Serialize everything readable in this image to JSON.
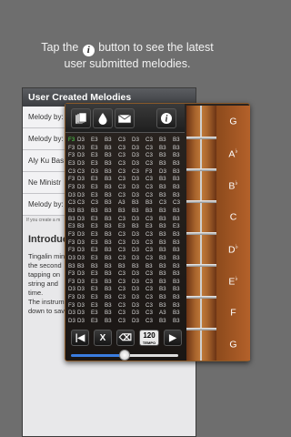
{
  "headline": {
    "line1_before": "Tap the",
    "info_glyph": "i",
    "line1_after": "button to see the latest",
    "line2": "user submitted melodies."
  },
  "background_page": {
    "title": "User Created Melodies",
    "rows": [
      "Melody by:",
      "Melody by:",
      "Aly Ku Bas",
      "Ne Ministr",
      "Melody by:"
    ],
    "note": "If you create a m",
    "intro_heading": "Introduc",
    "intro_lines": [
      "Tingalin min",
      "the second",
      "tapping on",
      "string and",
      "time.",
      "The instrum",
      "down to sav"
    ]
  },
  "toolbar": {
    "icons": [
      "pages-icon",
      "drop-icon",
      "mail-icon",
      "info-icon"
    ]
  },
  "grid_rows": [
    [
      "F3",
      "D3",
      "E3",
      "B3",
      "C3",
      "D3",
      "C3",
      "B3",
      "B3",
      "B3"
    ],
    [
      "F3",
      "D3",
      "E3",
      "B3",
      "C3",
      "D3",
      "C3",
      "B3",
      "B3",
      "B3"
    ],
    [
      "F3",
      "D3",
      "E3",
      "B3",
      "C3",
      "D3",
      "C3",
      "B3",
      "B3",
      "B3"
    ],
    [
      "E3",
      "D3",
      "E3",
      "B3",
      "C3",
      "D3",
      "C3",
      "B3",
      "B3",
      "B3"
    ],
    [
      "C3",
      "C3",
      "D3",
      "B3",
      "C3",
      "C3",
      "F3",
      "D3",
      "B3",
      "B3"
    ],
    [
      "F3",
      "D3",
      "E3",
      "B3",
      "C3",
      "D3",
      "C3",
      "B3",
      "B3",
      "B3"
    ],
    [
      "F3",
      "D3",
      "E3",
      "B3",
      "C3",
      "D3",
      "C3",
      "B3",
      "B3",
      "B3"
    ],
    [
      "D3",
      "D3",
      "E3",
      "B3",
      "C3",
      "D3",
      "C3",
      "B3",
      "B3",
      "B3"
    ],
    [
      "C3",
      "C3",
      "C3",
      "B3",
      "A3",
      "B3",
      "B3",
      "C3",
      "C3",
      ""
    ],
    [
      "B3",
      "B3",
      "B3",
      "B3",
      "B3",
      "B3",
      "B3",
      "B3",
      "B3",
      "B3"
    ],
    [
      "B3",
      "D3",
      "E3",
      "B3",
      "C3",
      "D3",
      "C3",
      "B3",
      "B3",
      "B3"
    ],
    [
      "E3",
      "B3",
      "E3",
      "B3",
      "E3",
      "B3",
      "E3",
      "B3",
      "E3",
      "B3"
    ],
    [
      "F3",
      "D3",
      "E3",
      "B3",
      "C3",
      "D3",
      "C3",
      "B3",
      "B3",
      "B3"
    ],
    [
      "F3",
      "D3",
      "E3",
      "B3",
      "C3",
      "D3",
      "C3",
      "B3",
      "B3",
      "B3"
    ],
    [
      "F3",
      "D3",
      "E3",
      "B3",
      "C3",
      "D3",
      "C3",
      "B3",
      "B3",
      "B3"
    ],
    [
      "D3",
      "D3",
      "E3",
      "B3",
      "C3",
      "D3",
      "C3",
      "B3",
      "B3",
      "B3"
    ],
    [
      "B3",
      "B3",
      "B3",
      "B3",
      "B3",
      "B3",
      "B3",
      "B3",
      "B3",
      "B3"
    ],
    [
      "F3",
      "D3",
      "E3",
      "B3",
      "C3",
      "D3",
      "C3",
      "B3",
      "B3",
      "B3"
    ],
    [
      "F3",
      "D3",
      "E3",
      "B3",
      "C3",
      "D3",
      "C3",
      "B3",
      "B3",
      "B3"
    ],
    [
      "D3",
      "D3",
      "E3",
      "B3",
      "C3",
      "D3",
      "C3",
      "B3",
      "B3",
      "B3"
    ],
    [
      "F3",
      "D3",
      "E3",
      "B3",
      "C3",
      "D3",
      "C3",
      "B3",
      "B3",
      "B3"
    ],
    [
      "F3",
      "D3",
      "E3",
      "B3",
      "C3",
      "D3",
      "C3",
      "B3",
      "B3",
      "B3"
    ],
    [
      "D3",
      "D3",
      "E3",
      "B3",
      "C3",
      "D3",
      "C3",
      "A3",
      "B3",
      "B3"
    ],
    [
      "D3",
      "D3",
      "E3",
      "B3",
      "C3",
      "D3",
      "C3",
      "B3",
      "B3",
      "B3"
    ]
  ],
  "controls": {
    "rewind_glyph": "|◀",
    "clear_label": "X",
    "backspace_glyph": "⌫",
    "tempo_value": "120",
    "tempo_label": "TEMPO",
    "play_glyph": "▶"
  },
  "slider": {
    "value": 0.5
  },
  "strings": [
    {
      "note": "G",
      "accidental": ""
    },
    {
      "note": "A",
      "accidental": "♭"
    },
    {
      "note": "B",
      "accidental": "♭"
    },
    {
      "note": "C",
      "accidental": ""
    },
    {
      "note": "D",
      "accidental": "♭"
    },
    {
      "note": "E",
      "accidental": "♭"
    },
    {
      "note": "F",
      "accidental": ""
    },
    {
      "note": "G",
      "accidental": ""
    }
  ]
}
